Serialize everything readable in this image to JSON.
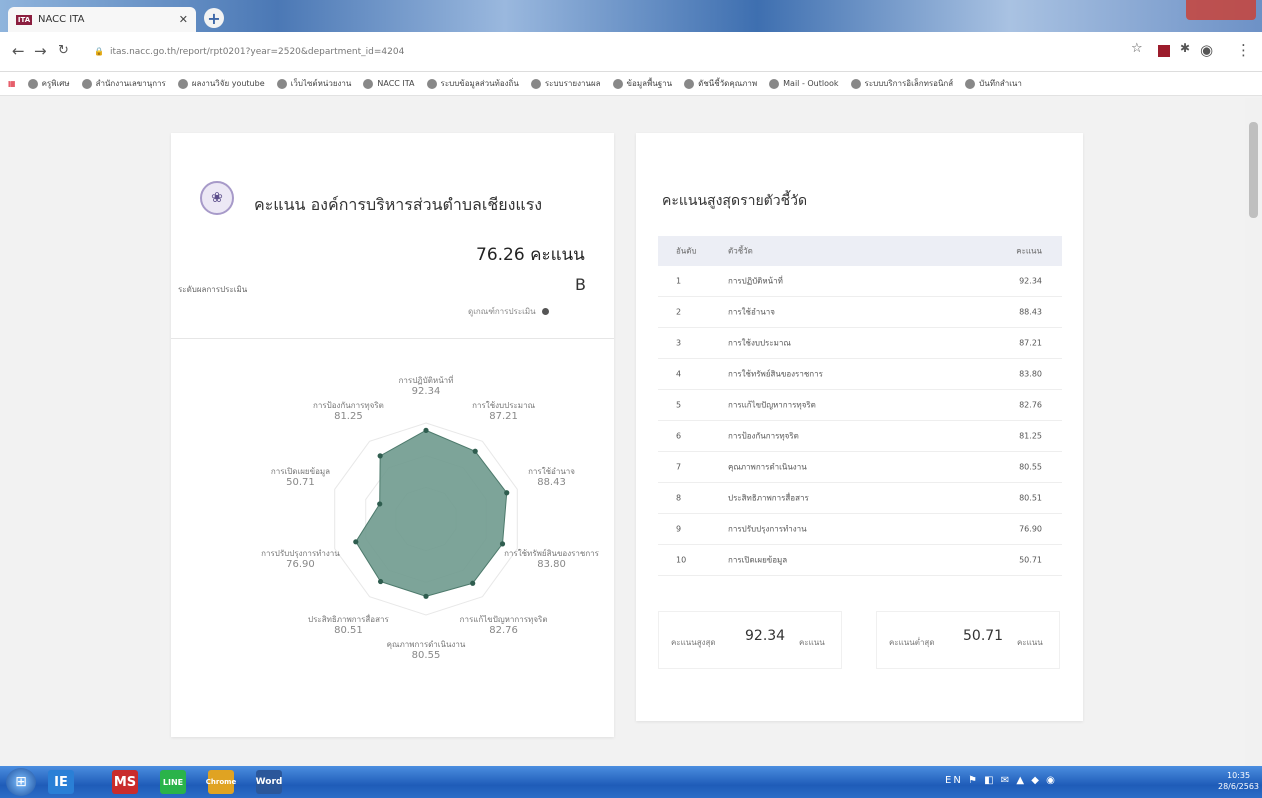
{
  "browser": {
    "tab_title": "NACC ITA",
    "tab_icon_text": "ITA",
    "url": "itas.nacc.go.th/report/rpt0201?year=2520&department_id=4204",
    "bookmarks": [
      "ครูพิเศษ",
      "สำนักงานเลขานุการ",
      "ผลงานวิจัย youtube",
      "เว็บไซต์หน่วยงาน",
      "NACC ITA",
      "ระบบข้อมูลส่วนท้องถิ่น",
      "ระบบรายงานผล",
      "ข้อมูลพื้นฐาน",
      "ดัชนีชี้วัดคุณภาพ",
      "Mail - Outlook",
      "ระบบบริการอิเล็กทรอนิกส์",
      "บันทึกสำเนา"
    ]
  },
  "org": {
    "name": "คะแนน องค์การบริหารส่วนตำบลเชียงแรง",
    "score": "76.26 คะแนน",
    "level_label": "ระดับผลการประเมิน",
    "grade": "B",
    "criteria_link": "ดูเกณฑ์การประเมิน"
  },
  "radar": {
    "max": 100,
    "fill_color": "#6f9a8e",
    "indicators": [
      {
        "label": "การปฏิบัติหน้าที่",
        "value": 92.34,
        "display": "92.34"
      },
      {
        "label": "การใช้งบประมาณ",
        "value": 87.21,
        "display": "87.21"
      },
      {
        "label": "การใช้อำนาจ",
        "value": 88.43,
        "display": "88.43"
      },
      {
        "label": "การใช้ทรัพย์สินของราชการ",
        "value": 83.8,
        "display": "83.80"
      },
      {
        "label": "การแก้ไขปัญหาการทุจริต",
        "value": 82.76,
        "display": "82.76"
      },
      {
        "label": "คุณภาพการดำเนินงาน",
        "value": 80.55,
        "display": "80.55"
      },
      {
        "label": "ประสิทธิภาพการสื่อสาร",
        "value": 80.51,
        "display": "80.51"
      },
      {
        "label": "การปรับปรุงการทำงาน",
        "value": 76.9,
        "display": "76.90"
      },
      {
        "label": "การเปิดเผยข้อมูล",
        "value": 50.71,
        "display": "50.71"
      },
      {
        "label": "การป้องกันการทุจริต",
        "value": 81.25,
        "display": "81.25"
      }
    ]
  },
  "ranking": {
    "title": "คะแนนสูงสุดรายตัวชี้วัด",
    "columns": [
      "อันดับ",
      "ตัวชี้วัด",
      "คะแนน"
    ],
    "rows": [
      {
        "rank": "1",
        "name": "การปฏิบัติหน้าที่",
        "score": "92.34"
      },
      {
        "rank": "2",
        "name": "การใช้อำนาจ",
        "score": "88.43"
      },
      {
        "rank": "3",
        "name": "การใช้งบประมาณ",
        "score": "87.21"
      },
      {
        "rank": "4",
        "name": "การใช้ทรัพย์สินของราชการ",
        "score": "83.80"
      },
      {
        "rank": "5",
        "name": "การแก้ไขปัญหาการทุจริต",
        "score": "82.76"
      },
      {
        "rank": "6",
        "name": "การป้องกันการทุจริต",
        "score": "81.25"
      },
      {
        "rank": "7",
        "name": "คุณภาพการดำเนินงาน",
        "score": "80.55"
      },
      {
        "rank": "8",
        "name": "ประสิทธิภาพการสื่อสาร",
        "score": "80.51"
      },
      {
        "rank": "9",
        "name": "การปรับปรุงการทำงาน",
        "score": "76.90"
      },
      {
        "rank": "10",
        "name": "การเปิดเผยข้อมูล",
        "score": "50.71"
      }
    ],
    "max_label": "คะแนนสูงสุด",
    "max_value": "92.34",
    "min_label": "คะแนนต่ำสุด",
    "min_value": "50.71",
    "unit": "คะแนน"
  },
  "taskbar": {
    "apps": [
      "IE",
      "MS",
      "LINE",
      "Chrome",
      "Word"
    ],
    "tray": "EN",
    "time": "10:35",
    "date": "28/6/2563"
  }
}
